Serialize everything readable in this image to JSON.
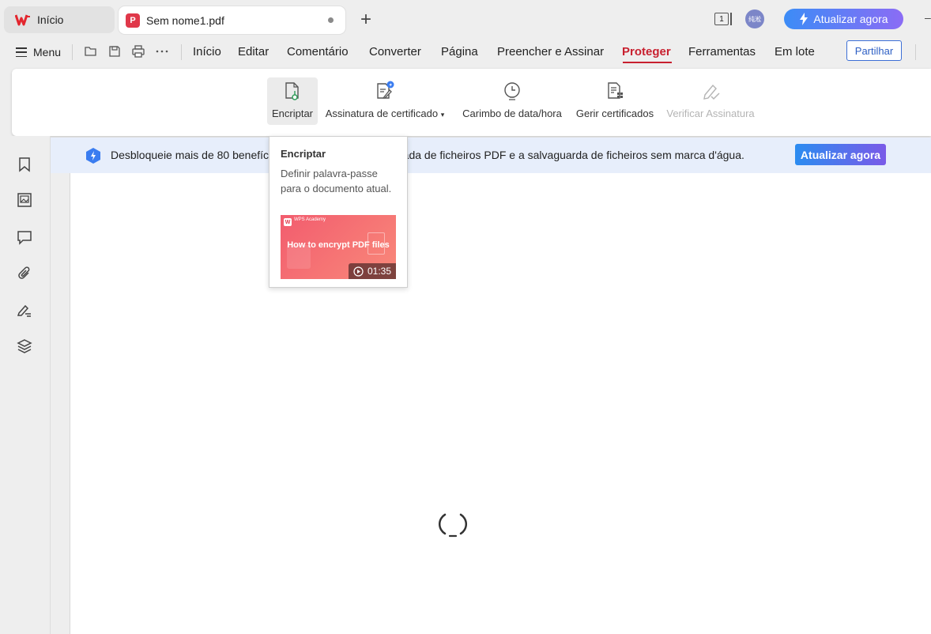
{
  "titlebar": {
    "home_tab": "Início",
    "doc_tab": "Sem nome1.pdf",
    "page_count": "1",
    "avatar_text": "纯淞",
    "upgrade_label": "Atualizar agora"
  },
  "menubar": {
    "menu_label": "Menu",
    "items": [
      "Início",
      "Editar",
      "Comentário",
      "Converter",
      "Página",
      "Preencher e Assinar",
      "Proteger",
      "Ferramentas",
      "Em lote"
    ],
    "active_item": "Proteger",
    "share_label": "Partilhar"
  },
  "ribbon": {
    "encrypt": "Encriptar",
    "cert_signature": "Assinatura de certificado",
    "timestamp": "Carimbo de data/hora",
    "manage_certs": "Gerir certificados",
    "verify_signature": "Verificar Assinatura"
  },
  "banner": {
    "text": "Desbloqueie mais de 80 benefícios, incluindo a edição ilimitada de ficheiros PDF e a salvaguarda de ficheiros sem marca d'água.",
    "upgrade_label": "Atualizar agora"
  },
  "tooltip": {
    "title": "Encriptar",
    "description": "Definir palavra-passe para o documento atual.",
    "video_brand": "W",
    "video_academy": "WPS Academy",
    "video_title": "How to encrypt PDF files",
    "video_duration": "01:35"
  },
  "colors": {
    "accent_red": "#c8202f",
    "upgrade_gradient_start": "#3c8cf6",
    "upgrade_gradient_end": "#8b6cf5",
    "banner_bg": "#e7eefb"
  }
}
